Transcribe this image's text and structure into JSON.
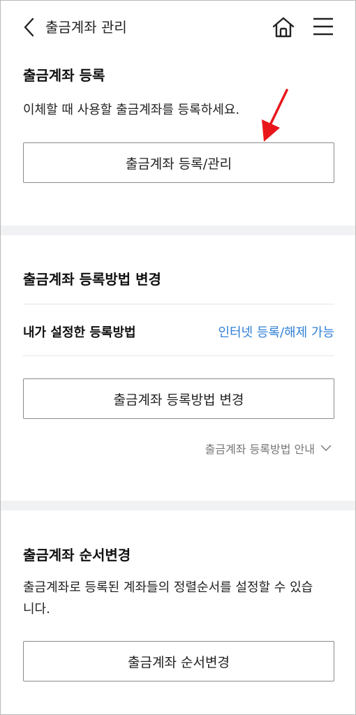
{
  "header": {
    "title": "출금계좌 관리",
    "icons": {
      "back": "chevron-left-icon",
      "home": "home-icon",
      "menu": "hamburger-menu-icon"
    }
  },
  "register": {
    "title": "출금계좌 등록",
    "description": "이체할 때 사용할 출금계좌를 등록하세요.",
    "button_label": "출금계좌 등록/관리"
  },
  "method": {
    "title": "출금계좌 등록방법 변경",
    "row_label": "내가 설정한 등록방법",
    "row_value": "인터넷 등록/해제 가능",
    "button_label": "출금계좌 등록방법 변경",
    "guide_label": "출금계좌 등록방법 안내"
  },
  "order": {
    "title": "출금계좌 순서변경",
    "description_line1": "출금계좌로 등록된 계좌들의 정렬순서를 설정할 수 있습",
    "description_line2": "니다.",
    "button_label": "출금계좌 순서변경"
  },
  "colors": {
    "accent_link": "#2f7fd6",
    "divider": "#f1f2f4",
    "annotation_arrow": "#e8161b"
  }
}
